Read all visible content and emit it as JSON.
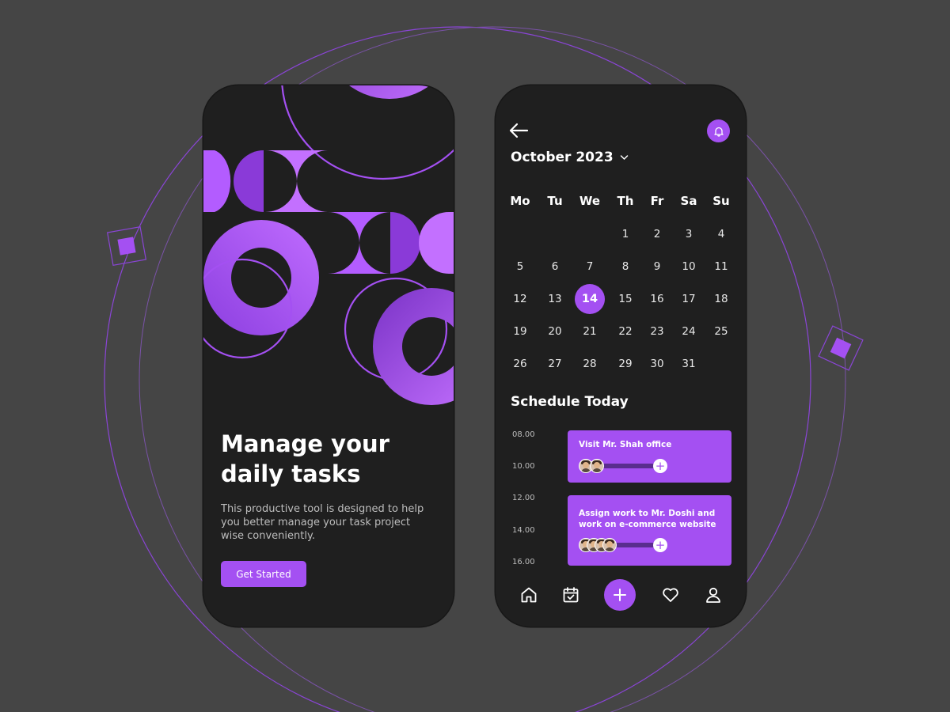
{
  "colors": {
    "background": "#454545",
    "phone": "#1f1f1f",
    "accent": "#a450f2",
    "accent_light": "#c370ff",
    "accent_dark": "#7d35c7",
    "muted_text": "#bdbdbd"
  },
  "onboarding": {
    "title_line1": "Manage your",
    "title_line2": "daily tasks",
    "description": "This productive tool is designed to help you better manage your task project wise conveniently.",
    "cta_label": "Get Started"
  },
  "calendar_screen": {
    "icons": {
      "back": "arrow-left-icon",
      "notifications": "bell-icon",
      "month_dropdown": "chevron-down-icon"
    },
    "month_label": "October 2023",
    "weekdays": [
      "Mo",
      "Tu",
      "We",
      "Th",
      "Fr",
      "Sa",
      "Su"
    ],
    "first_weekday_index": 3,
    "days_in_month": 31,
    "selected_day": 14,
    "schedule_title": "Schedule Today",
    "times": [
      "08.00",
      "10.00",
      "12.00",
      "14.00",
      "16.00"
    ],
    "tasks": [
      {
        "title": "Visit Mr. Shah office",
        "avatar_count": 2
      },
      {
        "title": "Assign work to Mr. Doshi and work on e-commerce website",
        "avatar_count": 4
      }
    ],
    "bottom_nav": [
      "home-icon",
      "calendar-check-icon",
      "plus-icon",
      "heart-icon",
      "user-icon"
    ]
  }
}
